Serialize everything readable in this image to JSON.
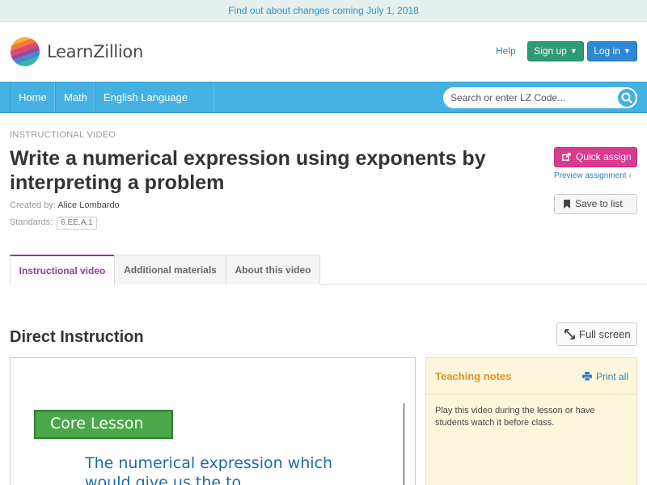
{
  "announcement": {
    "text": "Find out about changes coming July 1, 2018"
  },
  "header": {
    "brand": "LearnZillion",
    "help": "Help",
    "signup": "Sign up",
    "login": "Log in"
  },
  "nav": {
    "items": [
      {
        "label": "Home"
      },
      {
        "label": "Math"
      },
      {
        "label": "English Language Arts"
      }
    ],
    "search_placeholder": "Search or enter LZ Code..."
  },
  "lesson": {
    "kicker": "INSTRUCTIONAL VIDEO",
    "title": "Write a numerical expression using exponents by interpreting a problem",
    "created_label": "Created by:",
    "author": "Alice Lombardo",
    "standards_label": "Standards:",
    "standard": "6.EE.A.1"
  },
  "actions": {
    "quick_assign": "Quick assign",
    "preview": "Preview assignment ›",
    "save": "Save to list"
  },
  "tabs": [
    {
      "label": "Instructional video",
      "active": true
    },
    {
      "label": "Additional materials",
      "active": false
    },
    {
      "label": "About this video",
      "active": false
    }
  ],
  "section": {
    "title": "Direct Instruction",
    "fullscreen": "Full screen"
  },
  "video": {
    "core_lesson": "Core Lesson",
    "line1": "The numerical expression which",
    "line2": "would give us the to"
  },
  "notes": {
    "title": "Teaching notes",
    "print": "Print all",
    "body": "Play this video during the lesson or have students watch it before class."
  },
  "colors": {
    "nav": "#45b1e2",
    "signup": "#2f9a77",
    "login": "#2f88d3",
    "quick_assign": "#d93b8e",
    "active_tab": "#8b3f95",
    "notes_bg": "#fdf6dc",
    "notes_title": "#e0922a"
  }
}
